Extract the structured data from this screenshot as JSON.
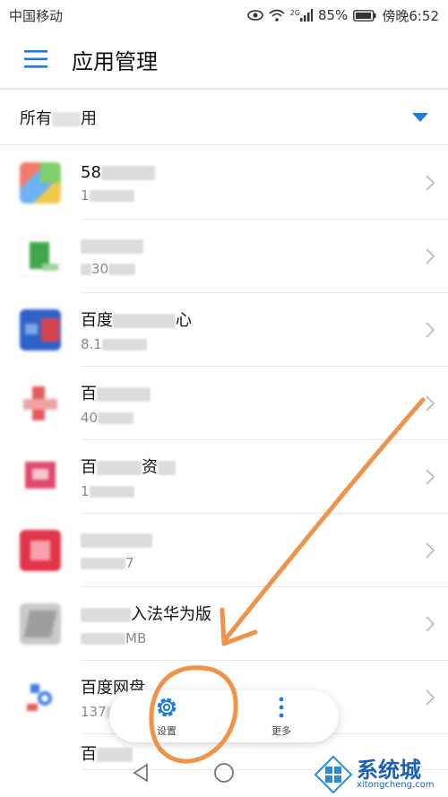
{
  "status_bar": {
    "carrier": "中国移动",
    "network": "2G",
    "battery": "85%",
    "time": "傍晚6:52",
    "icons": [
      "eye-icon",
      "wifi-icon",
      "signal-icon",
      "battery-icon"
    ]
  },
  "app_bar": {
    "title": "应用管理",
    "menu_icon": "hamburger-menu-icon"
  },
  "filter": {
    "label_prefix": "所有",
    "label_suffix": "用",
    "dropdown_icon": "triangle-down-icon"
  },
  "apps": [
    {
      "name": "58",
      "size": "1"
    },
    {
      "name": "",
      "size": "30"
    },
    {
      "name": "百度",
      "name_tail": "心",
      "size": "8.1"
    },
    {
      "name": "百",
      "size": "40"
    },
    {
      "name": "百",
      "name_tail": "资",
      "size": "1"
    },
    {
      "name": "",
      "size": "7"
    },
    {
      "name": "入法华为版",
      "size": "MB"
    },
    {
      "name": "百度网盘",
      "size": "137"
    },
    {
      "name": "百",
      "size": ""
    }
  ],
  "actions": {
    "settings_label": "设置",
    "more_label": "更多"
  },
  "watermark": {
    "main": "系统城",
    "sub": "xitongcheng.com"
  },
  "colors": {
    "accent": "#1f7ae0",
    "annotation": "#f0934a"
  }
}
